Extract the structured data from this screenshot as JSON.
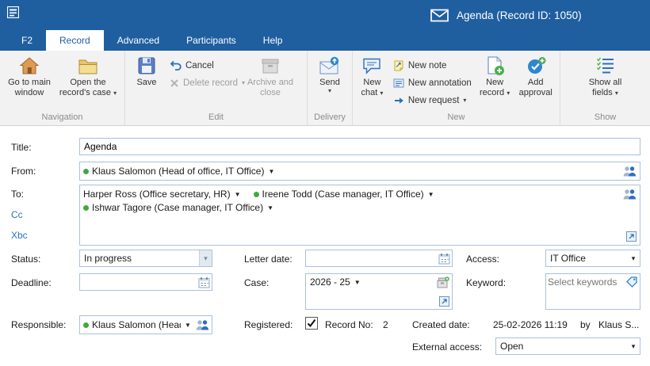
{
  "titlebar": {
    "title": "Agenda (Record ID: 1050)"
  },
  "tabs": {
    "f2": "F2",
    "record": "Record",
    "advanced": "Advanced",
    "participants": "Participants",
    "help": "Help"
  },
  "ribbon": {
    "navigation": {
      "caption": "Navigation",
      "go_to_main_window": "Go to main window",
      "open_records_case": "Open the record's case"
    },
    "edit": {
      "caption": "Edit",
      "save": "Save",
      "cancel": "Cancel",
      "delete_record": "Delete record",
      "archive_and_close": "Archive and close"
    },
    "delivery": {
      "caption": "Delivery",
      "send": "Send"
    },
    "new": {
      "caption": "New",
      "new_chat": "New chat",
      "new_note": "New note",
      "new_annotation": "New annotation",
      "new_request": "New request",
      "new_record": "New record",
      "add_approval": "Add approval"
    },
    "show": {
      "caption": "Show",
      "show_all_fields": "Show all fields"
    }
  },
  "form": {
    "title": {
      "label": "Title:",
      "value": "Agenda"
    },
    "from": {
      "label": "From:",
      "value": "Klaus Salomon (Head of office, IT Office)"
    },
    "to": {
      "label": "To:",
      "cc_label": "Cc",
      "xbc_label": "Xbc",
      "recipients": [
        {
          "name": "Harper Ross (Office secretary, HR)"
        },
        {
          "name": "Ireene Todd (Case manager, IT Office)"
        },
        {
          "name": "Ishwar Tagore (Case manager, IT Office)"
        }
      ]
    },
    "status": {
      "label": "Status:",
      "value": "In progress"
    },
    "letter_date": {
      "label": "Letter date:"
    },
    "access": {
      "label": "Access:",
      "value": "IT Office"
    },
    "deadline": {
      "label": "Deadline:"
    },
    "case": {
      "label": "Case:",
      "value": "2026 - 25"
    },
    "keyword": {
      "label": "Keyword:",
      "placeholder": "Select keywords"
    },
    "responsible": {
      "label": "Responsible:",
      "value": "Klaus Salomon (Head o"
    },
    "registered": {
      "label": "Registered:",
      "record_no_label": "Record No:",
      "record_no_value": "2"
    },
    "created": {
      "label": "Created date:",
      "value": "25-02-2026 11:19",
      "by_label": "by",
      "author": "Klaus S..."
    },
    "external_access": {
      "label": "External access:",
      "value": "Open"
    }
  }
}
